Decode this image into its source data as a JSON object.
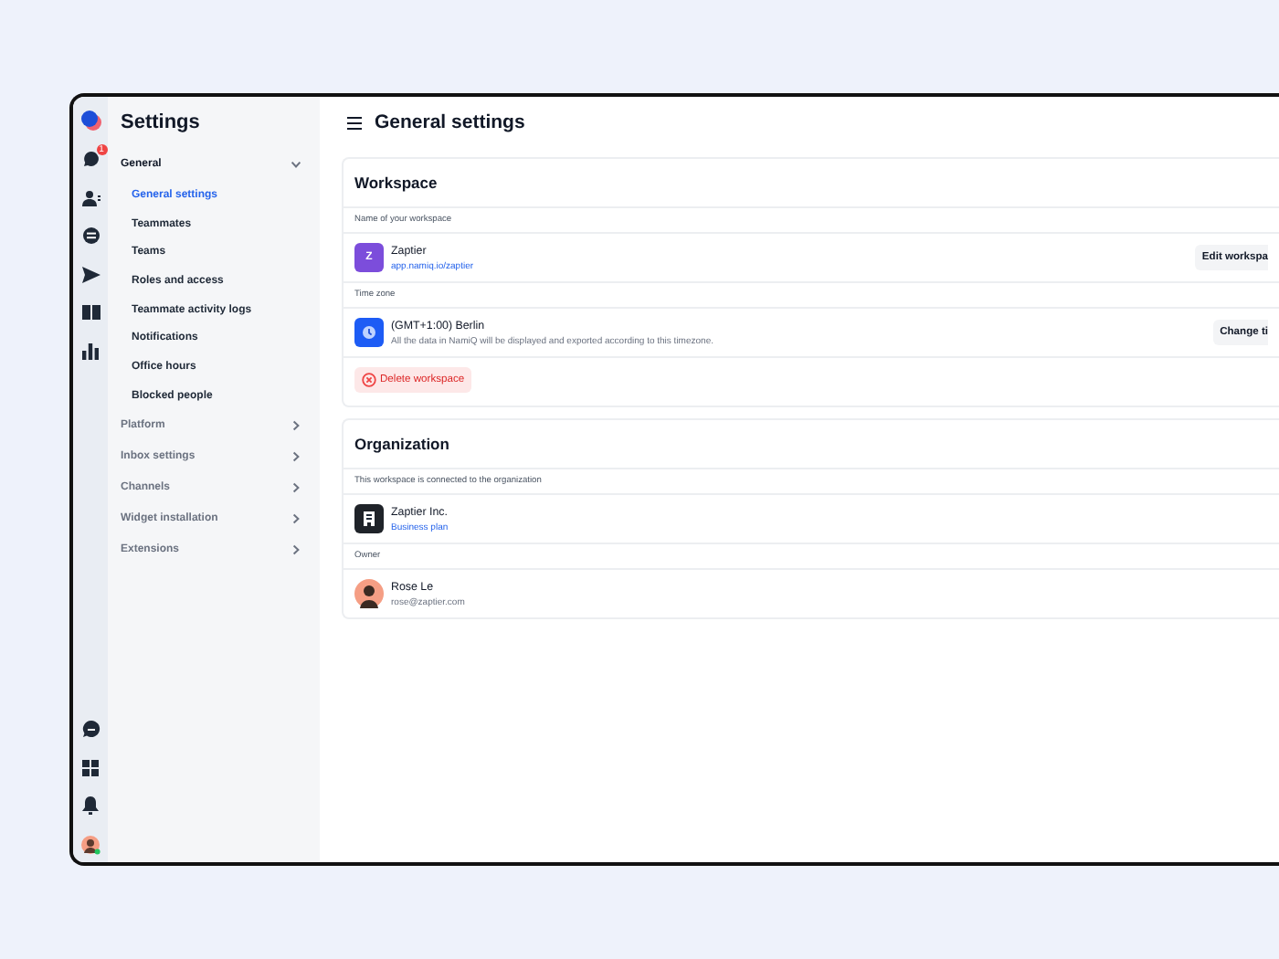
{
  "rail": {
    "top": [
      {
        "kind": "logo"
      },
      {
        "kind": "chat",
        "badge": "1"
      },
      {
        "kind": "contacts"
      },
      {
        "kind": "bot"
      },
      {
        "kind": "send"
      },
      {
        "kind": "book"
      },
      {
        "kind": "chart"
      }
    ],
    "bottom": [
      {
        "kind": "chat-alt"
      },
      {
        "kind": "apps"
      },
      {
        "kind": "bell"
      },
      {
        "kind": "avatar"
      }
    ]
  },
  "sidebar": {
    "title": "Settings",
    "items": [
      {
        "label": "General",
        "expanded": true,
        "children": [
          {
            "label": "General settings",
            "selected": true
          },
          {
            "label": "Teammates",
            "selected": false
          },
          {
            "label": "Teams",
            "selected": false
          },
          {
            "label": "Roles and access",
            "selected": false
          },
          {
            "label": "Teammate activity logs",
            "selected": false
          },
          {
            "label": "Notifications",
            "selected": false
          },
          {
            "label": "Office hours",
            "selected": false
          },
          {
            "label": "Blocked people",
            "selected": false
          }
        ]
      },
      {
        "label": "Platform",
        "expanded": false
      },
      {
        "label": "Inbox settings",
        "expanded": false
      },
      {
        "label": "Channels",
        "expanded": false
      },
      {
        "label": "Widget installation",
        "expanded": false
      },
      {
        "label": "Extensions",
        "expanded": false
      }
    ]
  },
  "page": {
    "title": "General settings"
  },
  "workspace": {
    "title": "Workspace",
    "name_label": "Name of your workspace",
    "name": "Zaptier",
    "initial": "Z",
    "url": "app.namiq.io/zaptier",
    "edit_button": "Edit workspa",
    "tz_label": "Time zone",
    "timezone": "(GMT+1:00) Berlin",
    "tz_note": "All the data in NamiQ will be displayed and exported according to this timezone.",
    "tz_button": "Change ti",
    "delete_button": "Delete workspace"
  },
  "organization": {
    "title": "Organization",
    "note": "This workspace is connected to the organization",
    "name": "Zaptier Inc.",
    "plan": "Business plan",
    "owner_label": "Owner",
    "owner_name": "Rose Le",
    "owner_email": "rose@zaptier.com"
  }
}
